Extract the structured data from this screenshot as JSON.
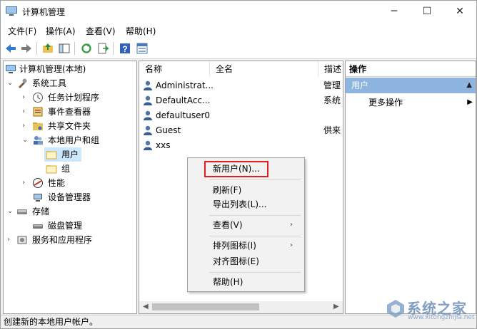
{
  "window": {
    "title": "计算机管理"
  },
  "menubar": {
    "items": [
      "文件(F)",
      "操作(A)",
      "查看(V)",
      "帮助(H)"
    ]
  },
  "toolbar": {
    "icons": [
      "back-icon",
      "forward-icon",
      "up-folder-icon",
      "show-hide-tree-icon",
      "refresh-icon",
      "export-list-icon",
      "help-icon",
      "properties-icon"
    ]
  },
  "tree": {
    "root": "计算机管理(本地)",
    "system_tools": "系统工具",
    "task_scheduler": "任务计划程序",
    "event_viewer": "事件查看器",
    "shared_folders": "共享文件夹",
    "local_users": "本地用户和组",
    "users": "用户",
    "groups": "组",
    "performance": "性能",
    "device_manager": "设备管理器",
    "storage": "存储",
    "disk_management": "磁盘管理",
    "services": "服务和应用程序"
  },
  "list": {
    "columns": [
      "名称",
      "全名",
      "描述"
    ],
    "rows": [
      {
        "name": "Administrat...",
        "desc": "管理"
      },
      {
        "name": "DefaultAcc...",
        "desc": "系统"
      },
      {
        "name": "defaultuser0",
        "desc": ""
      },
      {
        "name": "Guest",
        "desc": "供来"
      },
      {
        "name": "xxs",
        "desc": ""
      }
    ]
  },
  "actions": {
    "header": "操作",
    "section": "用户",
    "more": "更多操作"
  },
  "context_menu": {
    "new_user": "新用户(N)...",
    "refresh": "刷新(F)",
    "export": "导出列表(L)...",
    "view": "查看(V)",
    "arrange": "排列图标(I)",
    "align": "对齐图标(E)",
    "help": "帮助(H)"
  },
  "status": "创建新的本地用户帐户。",
  "watermark": {
    "text": "系统之家",
    "url": "www.xitongzhijia.net"
  },
  "colors": {
    "accent": "#8eb4e0",
    "highlight_box": "#e02020",
    "selection": "#cce8ff"
  }
}
